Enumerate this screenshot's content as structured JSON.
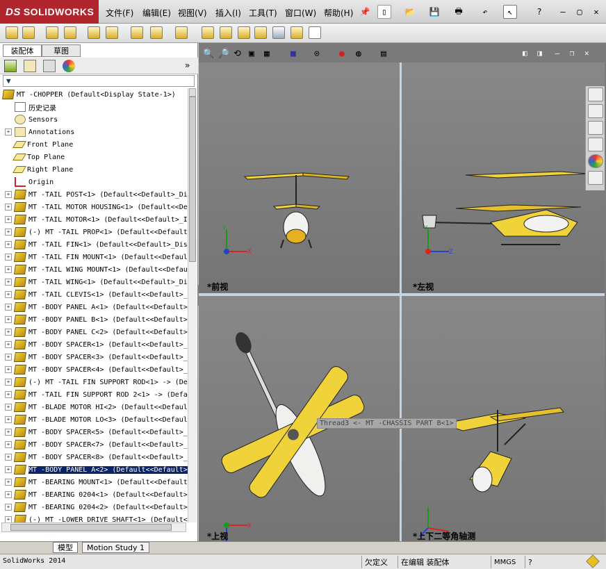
{
  "app": {
    "brand": "SOLIDWORKS",
    "brand_ds": "DS",
    "status_app": "SolidWorks 2014"
  },
  "menu": [
    {
      "label": "文件(F)"
    },
    {
      "label": "编辑(E)"
    },
    {
      "label": "视图(V)"
    },
    {
      "label": "插入(I)"
    },
    {
      "label": "工具(T)"
    },
    {
      "label": "窗口(W)"
    },
    {
      "label": "帮助(H)"
    }
  ],
  "panel_tabs": [
    "装配体",
    "草图"
  ],
  "tree": {
    "root": "MT -CHOPPER  (Default<Display State-1>)",
    "items": [
      {
        "label": "历史记录",
        "icon": "history-icon",
        "expandable": false
      },
      {
        "label": "Sensors",
        "icon": "sensor-icon",
        "expandable": false
      },
      {
        "label": "Annotations",
        "icon": "annotation-icon",
        "expandable": true
      },
      {
        "label": "Front Plane",
        "icon": "plane-icon",
        "expandable": false
      },
      {
        "label": "Top Plane",
        "icon": "plane-icon",
        "expandable": false
      },
      {
        "label": "Right Plane",
        "icon": "plane-icon",
        "expandable": false
      },
      {
        "label": "Origin",
        "icon": "origin-icon",
        "expandable": false
      },
      {
        "label": "MT -TAIL POST<1> (Default<<Default>_Di",
        "icon": "part-icon",
        "expandable": true
      },
      {
        "label": "MT -TAIL MOTOR HOUSING<1> (Default<<De",
        "icon": "part-icon",
        "expandable": true
      },
      {
        "label": "MT -TAIL MOTOR<1> (Default<<Default>_I",
        "icon": "part-icon",
        "expandable": true
      },
      {
        "label": "(-) MT -TAIL PROP<1> (Default<<Default",
        "icon": "part-icon",
        "expandable": true
      },
      {
        "label": "MT -TAIL FIN<1> (Default<<Default>_Dis",
        "icon": "part-icon",
        "expandable": true
      },
      {
        "label": "MT -TAIL FIN MOUNT<1> (Default<<Defaul",
        "icon": "part-icon",
        "expandable": true
      },
      {
        "label": "MT -TAIL WING MOUNT<1> (Default<<Defau",
        "icon": "part-icon",
        "expandable": true
      },
      {
        "label": "MT -TAIL WING<1> (Default<<Default>_Di",
        "icon": "part-icon",
        "expandable": true
      },
      {
        "label": "MT -TAIL CLEVIS<1> (Default<<Default>_",
        "icon": "part-icon",
        "expandable": true
      },
      {
        "label": "MT -BODY PANEL A<1> (Default<<Default>",
        "icon": "part-icon",
        "expandable": true
      },
      {
        "label": "MT -BODY PANEL B<1> (Default<<Default>",
        "icon": "part-icon",
        "expandable": true
      },
      {
        "label": "MT -BODY PANEL C<2> (Default<<Default>",
        "icon": "part-icon",
        "expandable": true
      },
      {
        "label": "MT -BODY SPACER<1> (Default<<Default>_",
        "icon": "part-icon",
        "expandable": true
      },
      {
        "label": "MT -BODY SPACER<3> (Default<<Default>_",
        "icon": "part-icon",
        "expandable": true
      },
      {
        "label": "MT -BODY SPACER<4> (Default<<Default>_",
        "icon": "part-icon",
        "expandable": true
      },
      {
        "label": "(-) MT -TAIL FIN SUPPORT ROD<1> -> (De",
        "icon": "part-icon",
        "expandable": true
      },
      {
        "label": "MT -TAIL FIN SUPPORT ROD 2<1> -> (Defa",
        "icon": "part-icon",
        "expandable": true
      },
      {
        "label": "MT -BLADE MOTOR HI<2> (Default<<Defaul",
        "icon": "part-icon",
        "expandable": true
      },
      {
        "label": "MT -BLADE MOTOR LO<3> (Default<<Defaul",
        "icon": "part-icon",
        "expandable": true
      },
      {
        "label": "MT -BODY SPACER<5> (Default<<Default>_",
        "icon": "part-icon",
        "expandable": true
      },
      {
        "label": "MT -BODY SPACER<7> (Default<<Default>_",
        "icon": "part-icon",
        "expandable": true
      },
      {
        "label": "MT -BODY SPACER<8> (Default<<Default>_",
        "icon": "part-icon",
        "expandable": true
      },
      {
        "label": "MT -BODY PANEL A<2> (Default<<Default>",
        "icon": "part-icon",
        "expandable": true,
        "selected": true
      },
      {
        "label": "MT -BEARING MOUNT<1> (Default<<Default>",
        "icon": "part-icon",
        "expandable": true
      },
      {
        "label": "MT -BEARING 0204<1> (Default<<Default>",
        "icon": "part-icon",
        "expandable": true
      },
      {
        "label": "MT -BEARING 0204<2> (Default<<Default>",
        "icon": "part-icon",
        "expandable": true
      },
      {
        "label": "(-) MT -LOWER DRIVE SHAFT<1> (Default<",
        "icon": "part-icon",
        "expandable": true
      }
    ]
  },
  "viewports": {
    "front": "*前视",
    "left": "*左视",
    "top": "*上视",
    "iso": "*上下二等角轴测"
  },
  "tooltip": "Thread3 <- MT -CHASSIS PART B<1>",
  "axes": {
    "x": "X",
    "y": "Y",
    "z": "Z"
  },
  "bottom_tabs": [
    "模型",
    "Motion Study 1"
  ],
  "status": {
    "undefined": "欠定义",
    "editing": "在编辑 装配体",
    "units": "MMGS",
    "help": "?"
  },
  "colors": {
    "brand_red": "#b1262c",
    "selection": "#0a246a",
    "part_yellow": "#f3d23a"
  }
}
